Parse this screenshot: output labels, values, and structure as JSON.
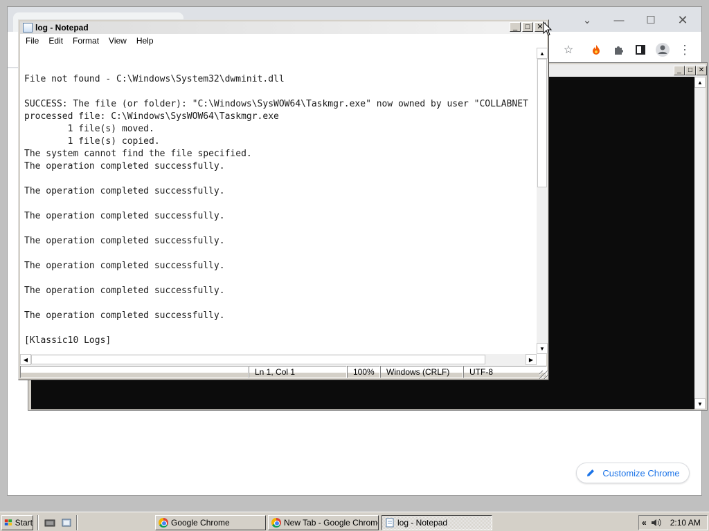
{
  "notepad": {
    "title": "log - Notepad",
    "menu": [
      "File",
      "Edit",
      "Format",
      "View",
      "Help"
    ],
    "content": "\nFile not found - C:\\Windows\\System32\\dwminit.dll\n\nSUCCESS: The file (or folder): \"C:\\Windows\\SysWOW64\\Taskmgr.exe\" now owned by user \"COLLABNET\nprocessed file: C:\\Windows\\SysWOW64\\Taskmgr.exe\n        1 file(s) moved.\n        1 file(s) copied.\nThe system cannot find the file specified.\nThe operation completed successfully.\n\nThe operation completed successfully.\n\nThe operation completed successfully.\n\nThe operation completed successfully.\n\nThe operation completed successfully.\n\nThe operation completed successfully.\n\nThe operation completed successfully.\n\n[Klassic10 Logs]",
    "status": {
      "position": "Ln 1, Col 1",
      "zoom": "100%",
      "line_ending": "Windows (CRLF)",
      "encoding": "UTF-8"
    }
  },
  "chrome": {
    "customize_label": "Customize Chrome"
  },
  "taskbar": {
    "start_label": "Start",
    "tasks": [
      {
        "label": "Google Chrome",
        "icon": "chrome-icon"
      },
      {
        "label": "New Tab - Google Chrome",
        "icon": "chrome-icon"
      },
      {
        "label": "log - Notepad",
        "icon": "notepad-icon"
      }
    ],
    "clock": "2:10 AM"
  }
}
